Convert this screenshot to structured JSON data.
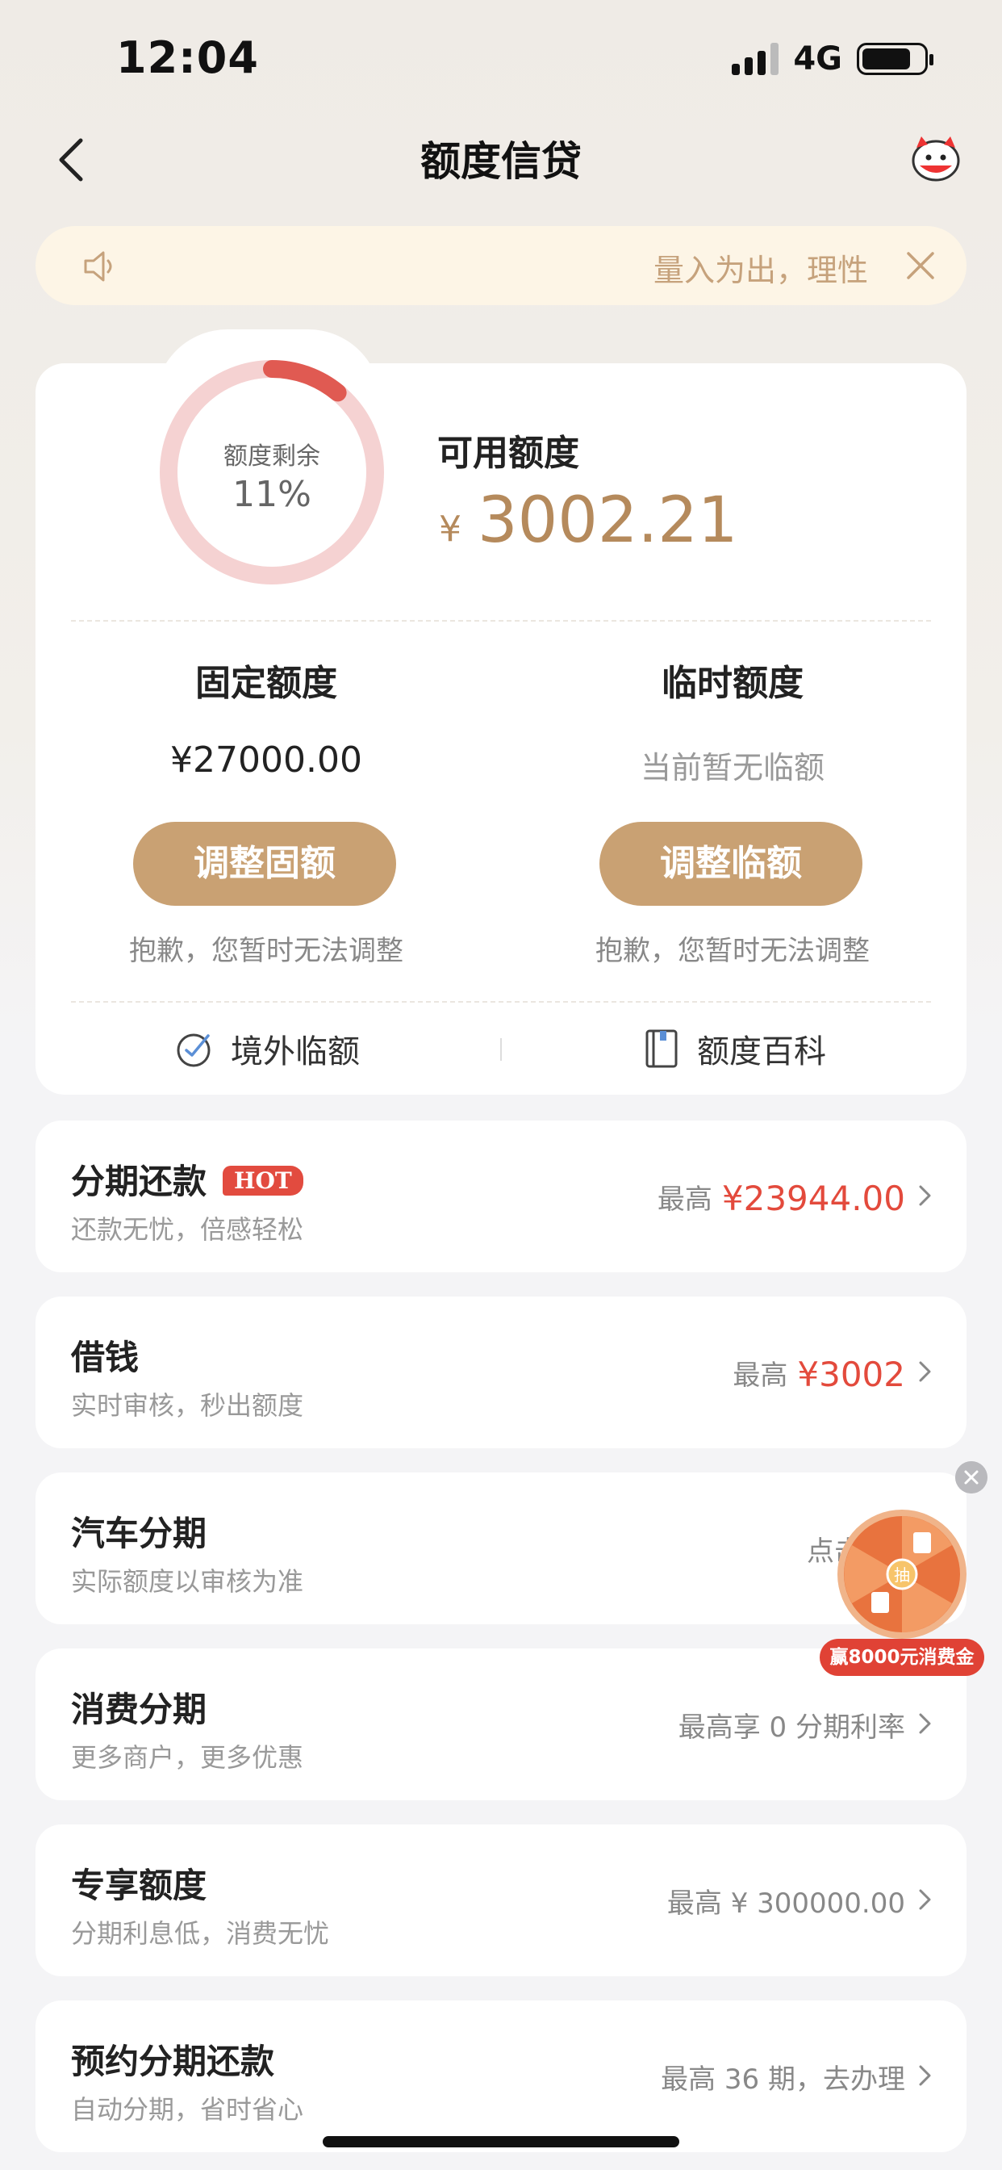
{
  "status_bar": {
    "time": "12:04",
    "network": "4G",
    "battery_level": 0.8
  },
  "nav": {
    "title": "额度信贷",
    "back_icon": "chevron-left-icon",
    "service_icon": "mascot-icon"
  },
  "notice": {
    "text": "量入为出，理性",
    "icon": "speaker-icon",
    "close_icon": "close-icon"
  },
  "credit": {
    "ring_label": "额度剩余",
    "ring_percent": "11%",
    "ring_fraction": 0.11,
    "available_label": "可用额度",
    "currency": "¥",
    "available_value": "3002.21",
    "fixed": {
      "title": "固定额度",
      "value": "¥27000.00",
      "button": "调整固额",
      "note": "抱歉，您暂时无法调整"
    },
    "temporary": {
      "title": "临时额度",
      "value": "当前暂无临额",
      "button": "调整临额",
      "note": "抱歉，您暂时无法调整"
    },
    "links": [
      {
        "label": "境外临额",
        "icon": "globe-check-icon"
      },
      {
        "label": "额度百科",
        "icon": "book-icon"
      }
    ]
  },
  "services": [
    {
      "title": "分期还款",
      "badge": "HOT",
      "subtitle": "还款无忧，倍感轻松",
      "right_prefix": "最高",
      "right_value": "¥23944.00"
    },
    {
      "title": "借钱",
      "subtitle": "实时审核，秒出额度",
      "right_prefix": "最高",
      "right_value": "¥3002"
    },
    {
      "title": "汽车分期",
      "subtitle": "实际额度以审核为准",
      "right_prefix": "点击",
      "right_value": ""
    },
    {
      "title": "消费分期",
      "subtitle": "更多商户，更多优惠",
      "right_prefix": "最高享 0 分期利率",
      "right_value": ""
    },
    {
      "title": "专享额度",
      "subtitle": "分期利息低，消费无忧",
      "right_prefix": "最高 ¥ 300000.00",
      "right_value": ""
    },
    {
      "title": "预约分期还款",
      "subtitle": "自动分期，省时省心",
      "right_prefix": "最高 36 期，去办理",
      "right_value": ""
    }
  ],
  "floating": {
    "wheel_center": "抽",
    "badge": "赢8000元消费金"
  },
  "colors": {
    "accent_gold": "#c9a173",
    "amount_gold": "#b58a5c",
    "red": "#e34a3c",
    "ring_track": "#f2cbcb",
    "ring_fill": "#e05a52"
  }
}
